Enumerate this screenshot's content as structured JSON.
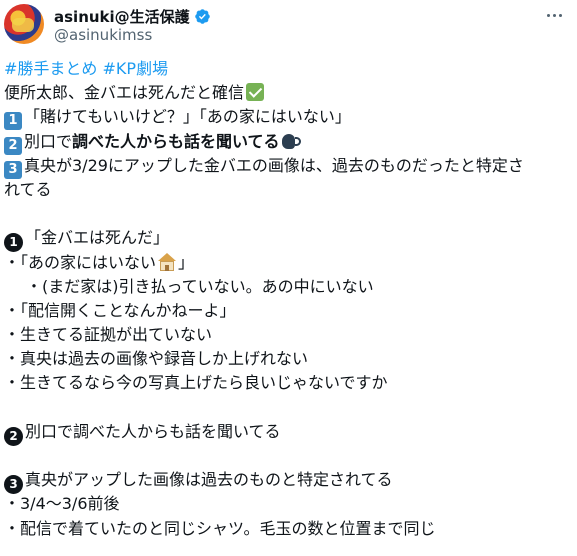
{
  "author": {
    "display_name": "asinuki@生活保護",
    "handle": "@asinukimss",
    "verified": true,
    "avatar_icon": "user-avatar-image",
    "more_icon": "more-dots-icon"
  },
  "tweet": {
    "hashtags": [
      "#勝手まとめ",
      "#KP劇場"
    ],
    "intro": "便所太郎、金バエは死んだと確信",
    "points": [
      {
        "num": "1",
        "text": "「賭けてもいいけど？」「あの家にはいない」"
      },
      {
        "num": "2",
        "text_plain": "別口で",
        "text_bold": "調べた人からも話を聞いてる"
      },
      {
        "num": "3",
        "text_line1": "真央が3/29にアップした金バエの画像は、過去のものだったと特定さ",
        "text_line2": "れてる"
      }
    ],
    "section1": {
      "num": "1",
      "title": "「金バエは死んだ」",
      "items": [
        "・「あの家にはいない",
        "」",
        "・(まだ家は)引き払っていない。あの中にいない",
        "・「配信開くことなんかねーよ」",
        "・生きてる証拠が出ていない",
        "・真央は過去の画像や録音しか上げれない",
        "・生きてるなら今の写真上げたら良いじゃないですか"
      ]
    },
    "section2": {
      "num": "2",
      "title": "別口で調べた人からも話を聞いてる"
    },
    "section3": {
      "num": "3",
      "title": "真央がアップした画像は過去のものと特定されてる",
      "items": [
        "・3/4～3/6前後",
        "・配信で着ていたのと同じシャツ。毛玉の数と位置まで同じ"
      ]
    }
  },
  "colors": {
    "link": "#1d9bf0",
    "text": "#0f1419",
    "muted": "#536471",
    "keycap": "#3b88c3",
    "verified": "#1d9bf0"
  }
}
